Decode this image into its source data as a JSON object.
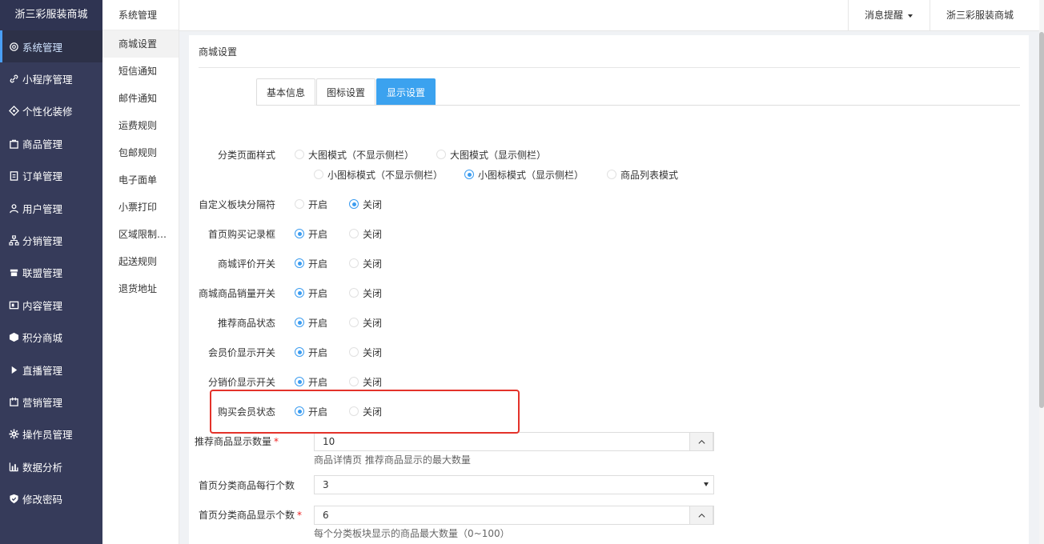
{
  "brand": "浙三彩服装商城",
  "sidebar": {
    "items": [
      {
        "label": "系统管理",
        "icon": "settings-icon"
      },
      {
        "label": "小程序管理",
        "icon": "link-icon"
      },
      {
        "label": "个性化装修",
        "icon": "decorate-icon"
      },
      {
        "label": "商品管理",
        "icon": "bag-icon"
      },
      {
        "label": "订单管理",
        "icon": "clipboard-icon"
      },
      {
        "label": "用户管理",
        "icon": "user-icon"
      },
      {
        "label": "分销管理",
        "icon": "network-icon"
      },
      {
        "label": "联盟管理",
        "icon": "store-icon"
      },
      {
        "label": "内容管理",
        "icon": "content-icon"
      },
      {
        "label": "积分商城",
        "icon": "cube-icon"
      },
      {
        "label": "直播管理",
        "icon": "play-icon"
      },
      {
        "label": "营销管理",
        "icon": "marketing-icon"
      },
      {
        "label": "操作员管理",
        "icon": "gear-icon"
      },
      {
        "label": "数据分析",
        "icon": "bar-chart-icon"
      },
      {
        "label": "修改密码",
        "icon": "shield-icon"
      }
    ]
  },
  "subnav": {
    "title": "系统管理",
    "items": [
      "商城设置",
      "短信通知",
      "邮件通知",
      "运费规则",
      "包邮规则",
      "电子面单",
      "小票打印",
      "区域限制…",
      "起送规则",
      "退货地址"
    ]
  },
  "header": {
    "notifications": "消息提醒",
    "store": "浙三彩服装商城"
  },
  "panel": {
    "title": "商城设置",
    "tabs": [
      "基本信息",
      "图标设置",
      "显示设置"
    ]
  },
  "settings": {
    "category_style": {
      "label": "分类页面样式",
      "options": [
        "大图模式（不显示侧栏）",
        "大图模式（显示侧栏）",
        "小图标模式（不显示侧栏）",
        "小图标模式（显示侧栏）",
        "商品列表模式"
      ]
    },
    "toggles": [
      {
        "label": "自定义板块分隔符",
        "on": "开启",
        "off": "关闭",
        "selected": "off"
      },
      {
        "label": "首页购买记录框",
        "on": "开启",
        "off": "关闭",
        "selected": "on"
      },
      {
        "label": "商城评价开关",
        "on": "开启",
        "off": "关闭",
        "selected": "on"
      },
      {
        "label": "商城商品销量开关",
        "on": "开启",
        "off": "关闭",
        "selected": "on"
      },
      {
        "label": "推荐商品状态",
        "on": "开启",
        "off": "关闭",
        "selected": "on"
      },
      {
        "label": "会员价显示开关",
        "on": "开启",
        "off": "关闭",
        "selected": "on"
      },
      {
        "label": "分销价显示开关",
        "on": "开启",
        "off": "关闭",
        "selected": "on"
      },
      {
        "label": "购买会员状态",
        "on": "开启",
        "off": "关闭",
        "selected": "on"
      }
    ],
    "recommend_count": {
      "label": "推荐商品显示数量",
      "required": "*",
      "value": "10",
      "help": "商品详情页 推荐商品显示的最大数量"
    },
    "per_row": {
      "label": "首页分类商品每行个数",
      "value": "3"
    },
    "display_count": {
      "label": "首页分类商品显示个数",
      "required": "*",
      "value": "6",
      "help": "每个分类板块显示的商品最大数量（0~100）"
    }
  },
  "colors": {
    "sidebar_bg": "#363b5a",
    "accent": "#3ba2ef",
    "highlight": "#e4322a"
  }
}
